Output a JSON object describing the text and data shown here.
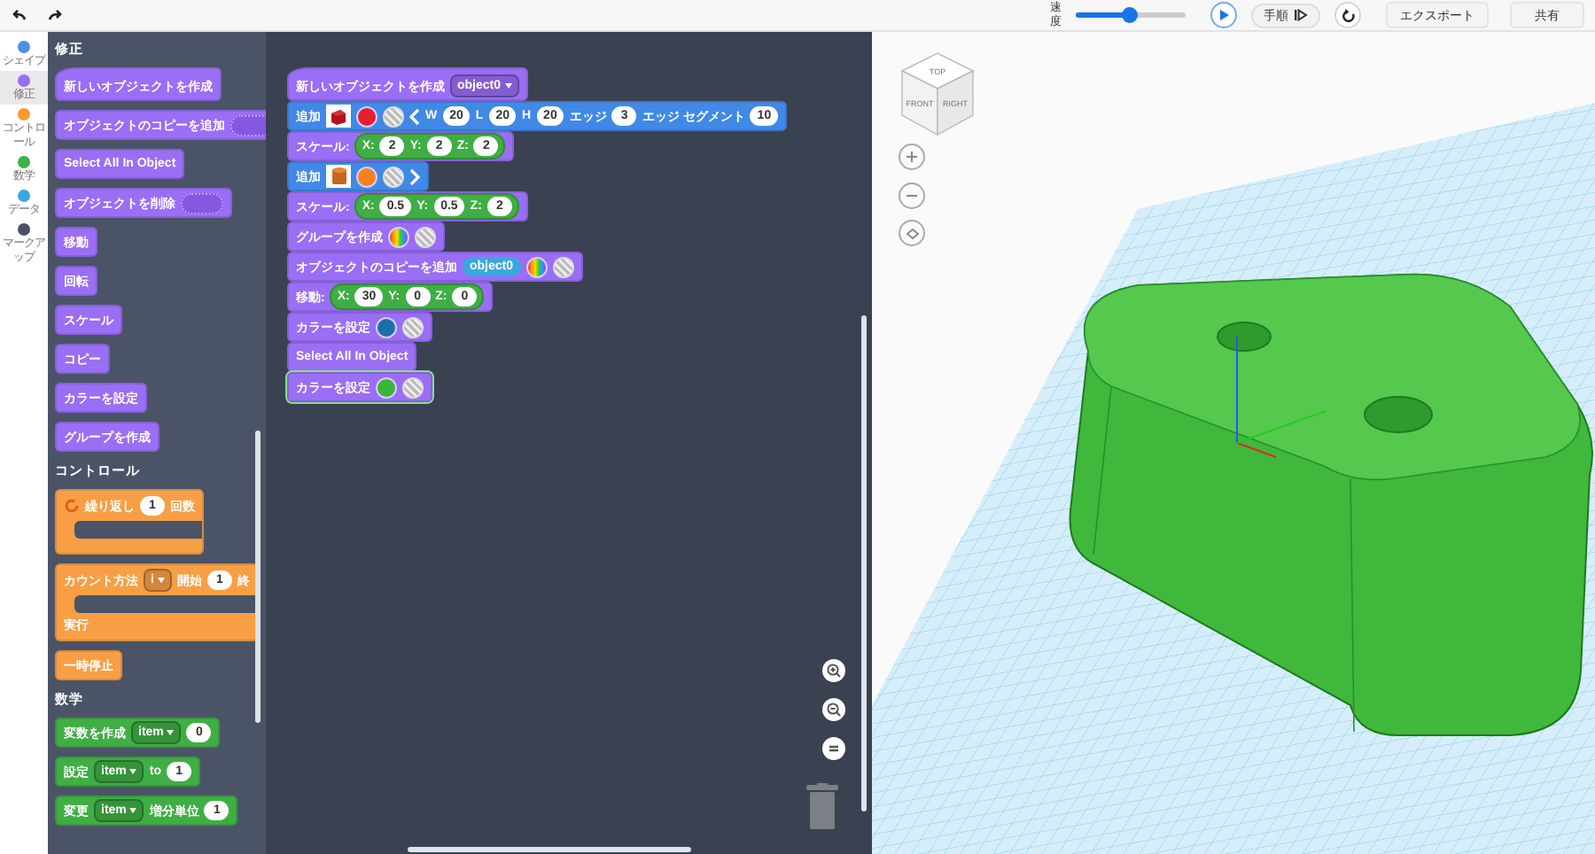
{
  "toolbar": {
    "speed_label": "速度",
    "speed": {
      "level": 0.48
    },
    "step_button": "手順",
    "export_button": "エクスポート",
    "share_button": "共有"
  },
  "categories": [
    {
      "label": "シェイプ",
      "color": "#4c8fe8",
      "selected": false
    },
    {
      "label": "修正",
      "color": "#9a6ef5",
      "selected": true
    },
    {
      "label": "コントロール",
      "color": "#f89a2c",
      "selected": false
    },
    {
      "label": "数学",
      "color": "#3bb14a",
      "selected": false
    },
    {
      "label": "データ",
      "color": "#3aa8e0",
      "selected": false
    },
    {
      "label": "マークアップ",
      "color": "#4a5363",
      "selected": false
    }
  ],
  "flyout": [
    {
      "heading": "修正",
      "blocks": [
        {
          "kind": "hat",
          "color": "#9a6ef5",
          "parts": [
            {
              "kind": "text",
              "text": "新しいオブジェクトを作成"
            }
          ]
        },
        {
          "kind": "stack",
          "color": "#9a6ef5",
          "parts": [
            {
              "kind": "text",
              "text": "オブジェクトのコピーを追加"
            },
            {
              "kind": "slot"
            }
          ]
        },
        {
          "kind": "stack",
          "color": "#9a6ef5",
          "parts": [
            {
              "kind": "text",
              "text": "Select All In Object"
            }
          ]
        },
        {
          "kind": "stack",
          "color": "#9a6ef5",
          "parts": [
            {
              "kind": "text",
              "text": "オブジェクトを削除"
            },
            {
              "kind": "slot"
            }
          ]
        },
        {
          "kind": "stack",
          "color": "#9a6ef5",
          "parts": [
            {
              "kind": "text",
              "text": "移動"
            }
          ]
        },
        {
          "kind": "stack",
          "color": "#9a6ef5",
          "parts": [
            {
              "kind": "text",
              "text": "回転"
            }
          ]
        },
        {
          "kind": "stack",
          "color": "#9a6ef5",
          "parts": [
            {
              "kind": "text",
              "text": "スケール"
            }
          ]
        },
        {
          "kind": "stack",
          "color": "#9a6ef5",
          "parts": [
            {
              "kind": "text",
              "text": "コピー"
            }
          ]
        },
        {
          "kind": "stack",
          "color": "#9a6ef5",
          "parts": [
            {
              "kind": "text",
              "text": "カラーを設定"
            }
          ]
        },
        {
          "kind": "stack",
          "color": "#9a6ef5",
          "parts": [
            {
              "kind": "text",
              "text": "グループを作成"
            }
          ]
        }
      ]
    },
    {
      "heading": "コントロール",
      "blocks": [
        {
          "kind": "c",
          "color": "#f89f45",
          "parts": [
            {
              "kind": "loop-icon"
            },
            {
              "kind": "text",
              "text": "繰り返し"
            },
            {
              "kind": "num",
              "text": "1"
            },
            {
              "kind": "text",
              "text": "回数"
            }
          ]
        },
        {
          "kind": "c",
          "color": "#f89f45",
          "footer": "実行",
          "parts": [
            {
              "kind": "text",
              "text": "カウント方法"
            },
            {
              "kind": "dropdown",
              "text": "i"
            },
            {
              "kind": "text",
              "text": "開始"
            },
            {
              "kind": "num",
              "text": "1"
            },
            {
              "kind": "text",
              "text": "終"
            }
          ]
        },
        {
          "kind": "stack",
          "color": "#f89f45",
          "parts": [
            {
              "kind": "text",
              "text": "一時停止"
            }
          ]
        }
      ]
    },
    {
      "heading": "数学",
      "blocks": [
        {
          "kind": "stack",
          "color": "#3fae44",
          "parts": [
            {
              "kind": "text",
              "text": "変数を作成"
            },
            {
              "kind": "dropdown",
              "text": "item"
            },
            {
              "kind": "num",
              "text": "0"
            }
          ]
        },
        {
          "kind": "stack",
          "color": "#3fae44",
          "parts": [
            {
              "kind": "text",
              "text": "設定"
            },
            {
              "kind": "dropdown",
              "text": "item"
            },
            {
              "kind": "text",
              "text": "to"
            },
            {
              "kind": "num",
              "text": "1"
            }
          ]
        },
        {
          "kind": "stack",
          "color": "#3fae44",
          "parts": [
            {
              "kind": "text",
              "text": "変更"
            },
            {
              "kind": "dropdown",
              "text": "item"
            },
            {
              "kind": "text",
              "text": "増分単位"
            },
            {
              "kind": "num",
              "text": "1"
            }
          ]
        }
      ]
    }
  ],
  "workspace": {
    "blocks": [
      {
        "kind": "hat",
        "color": "#9a6ef5",
        "selected": false,
        "parts": [
          {
            "kind": "text",
            "text": "新しいオブジェクトを作成"
          },
          {
            "kind": "dropdown",
            "text": "object0"
          }
        ]
      },
      {
        "kind": "stack",
        "color": "#4189e6",
        "selected": false,
        "parts": [
          {
            "kind": "text",
            "text": "追加"
          },
          {
            "kind": "cube"
          },
          {
            "kind": "color",
            "color": "#e3202b"
          },
          {
            "kind": "random"
          },
          {
            "kind": "chevron-left"
          },
          {
            "kind": "text",
            "text": "W"
          },
          {
            "kind": "num",
            "text": "20"
          },
          {
            "kind": "text",
            "text": "L"
          },
          {
            "kind": "num",
            "text": "20"
          },
          {
            "kind": "text",
            "text": "H"
          },
          {
            "kind": "num",
            "text": "20"
          },
          {
            "kind": "text",
            "text": "エッジ"
          },
          {
            "kind": "num",
            "text": "3"
          },
          {
            "kind": "text",
            "text": "エッジ セグメント"
          },
          {
            "kind": "num",
            "text": "10"
          }
        ]
      },
      {
        "kind": "stack",
        "color": "#9a6ef5",
        "selected": false,
        "parts": [
          {
            "kind": "text",
            "text": "スケール:"
          },
          {
            "kind": "vector",
            "items": [
              {
                "label": "X:",
                "value": "2"
              },
              {
                "label": "Y:",
                "value": "2"
              },
              {
                "label": "Z:",
                "value": "2"
              }
            ]
          }
        ]
      },
      {
        "kind": "stack",
        "color": "#4189e6",
        "selected": false,
        "parts": [
          {
            "kind": "text",
            "text": "追加"
          },
          {
            "kind": "cylinder"
          },
          {
            "kind": "color",
            "color": "#f5821f"
          },
          {
            "kind": "random"
          },
          {
            "kind": "chevron-right"
          }
        ]
      },
      {
        "kind": "stack",
        "color": "#9a6ef5",
        "selected": false,
        "parts": [
          {
            "kind": "text",
            "text": "スケール:"
          },
          {
            "kind": "vector",
            "items": [
              {
                "label": "X:",
                "value": "0.5"
              },
              {
                "label": "Y:",
                "value": "0.5"
              },
              {
                "label": "Z:",
                "value": "2"
              }
            ]
          }
        ]
      },
      {
        "kind": "stack",
        "color": "#9a6ef5",
        "selected": false,
        "parts": [
          {
            "kind": "text",
            "text": "グループを作成"
          },
          {
            "kind": "rainbow"
          },
          {
            "kind": "random"
          }
        ]
      },
      {
        "kind": "stack",
        "color": "#9a6ef5",
        "selected": false,
        "parts": [
          {
            "kind": "text",
            "text": "オブジェクトのコピーを追加"
          },
          {
            "kind": "variable",
            "text": "object0"
          },
          {
            "kind": "rainbow"
          },
          {
            "kind": "random"
          }
        ]
      },
      {
        "kind": "stack",
        "color": "#9a6ef5",
        "selected": false,
        "parts": [
          {
            "kind": "text",
            "text": "移動:"
          },
          {
            "kind": "vector",
            "items": [
              {
                "label": "X:",
                "value": "30"
              },
              {
                "label": "Y:",
                "value": "0"
              },
              {
                "label": "Z:",
                "value": "0"
              }
            ]
          }
        ]
      },
      {
        "kind": "stack",
        "color": "#9a6ef5",
        "selected": false,
        "parts": [
          {
            "kind": "text",
            "text": "カラーを設定"
          },
          {
            "kind": "color",
            "color": "#1b6fa6"
          },
          {
            "kind": "random"
          }
        ]
      },
      {
        "kind": "stack",
        "color": "#9a6ef5",
        "selected": false,
        "parts": [
          {
            "kind": "text",
            "text": "Select All In Object"
          }
        ]
      },
      {
        "kind": "stack",
        "color": "#9a6ef5",
        "selected": true,
        "parts": [
          {
            "kind": "text",
            "text": "カラーを設定"
          },
          {
            "kind": "color",
            "color": "#3bb53b"
          },
          {
            "kind": "random"
          }
        ]
      }
    ]
  },
  "viewport": {
    "cube_faces": [
      "TOP",
      "FRONT",
      "RIGHT"
    ]
  }
}
